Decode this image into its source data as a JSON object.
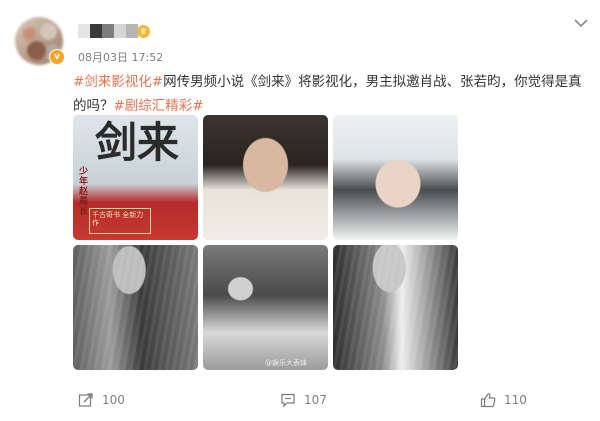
{
  "post": {
    "date_time": "08月03日 17:52",
    "text_parts": [
      {
        "type": "tag",
        "text": "#剑来影视化#"
      },
      {
        "type": "text",
        "text": "网传男频小说《剑来》将影视化，男主拟邀肖战、张若昀，你觉得是真的吗？"
      },
      {
        "type": "tag",
        "text": "#剧综汇精彩#"
      }
    ]
  },
  "images": {
    "p1_title": "剑来",
    "p1_sub": "少年赵晨长",
    "p1_box": "千古奇书 全新力作",
    "p5_watermark": "@娱乐大表妹"
  },
  "actions": {
    "repost_count": "100",
    "comment_count": "107",
    "like_count": "110"
  },
  "colors": {
    "tag": "#eb7350",
    "meta": "#808080",
    "vip_badge": "#f6a623"
  }
}
